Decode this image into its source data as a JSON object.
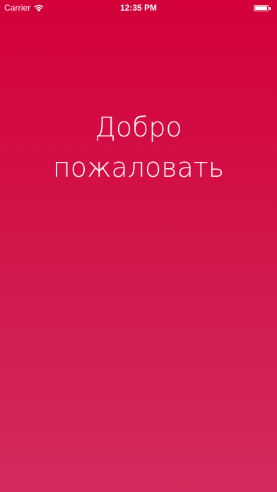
{
  "status_bar": {
    "carrier": "Carrier",
    "time": "12:35 PM",
    "battery_level": 1.0
  },
  "welcome": {
    "line1": "Добро",
    "line2": "пожаловать"
  },
  "colors": {
    "background_top": "#d3003a",
    "background_bottom": "#d32b5d",
    "text": "#ffffff"
  }
}
